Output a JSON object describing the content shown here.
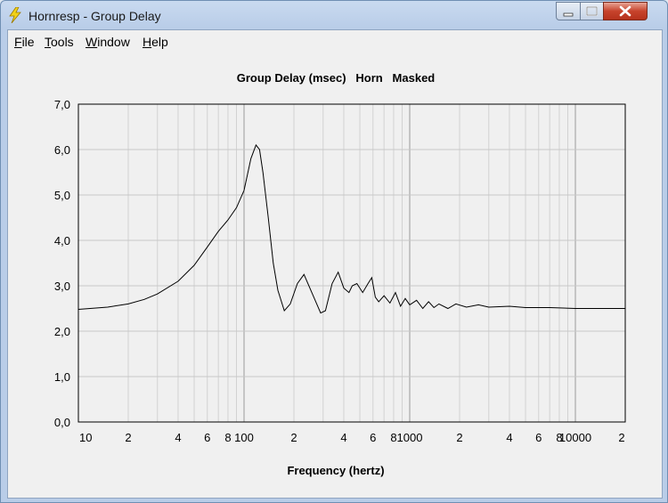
{
  "window": {
    "title": "Hornresp - Group Delay",
    "icon": "lightning-bolt-icon",
    "controls": [
      "minimize-icon",
      "maximize-icon",
      "close-icon"
    ]
  },
  "menu": {
    "items": [
      {
        "label": "File",
        "accel": "F"
      },
      {
        "label": "Tools",
        "accel": "T"
      },
      {
        "label": "Window",
        "accel": "W"
      },
      {
        "label": "Help",
        "accel": "H"
      }
    ]
  },
  "chart_data": {
    "type": "line",
    "title": "Group Delay (msec)   Horn   Masked",
    "xlabel": "Frequency (hertz)",
    "ylabel": "",
    "x_scale": "log",
    "xlim": [
      10,
      20000
    ],
    "ylim": [
      0,
      7
    ],
    "grid": true,
    "y_ticks": [
      "0,0",
      "1,0",
      "2,0",
      "3,0",
      "4,0",
      "5,0",
      "6,0",
      "7,0"
    ],
    "x_ticks": [
      {
        "v": 10,
        "label": "10"
      },
      {
        "v": 20,
        "label": "2"
      },
      {
        "v": 40,
        "label": "4"
      },
      {
        "v": 60,
        "label": "6"
      },
      {
        "v": 80,
        "label": "8"
      },
      {
        "v": 100,
        "label": "100"
      },
      {
        "v": 200,
        "label": "2"
      },
      {
        "v": 400,
        "label": "4"
      },
      {
        "v": 600,
        "label": "6"
      },
      {
        "v": 800,
        "label": "8"
      },
      {
        "v": 1000,
        "label": "1000"
      },
      {
        "v": 2000,
        "label": "2"
      },
      {
        "v": 4000,
        "label": "4"
      },
      {
        "v": 6000,
        "label": "6"
      },
      {
        "v": 8000,
        "label": "8"
      },
      {
        "v": 10000,
        "label": "10000"
      },
      {
        "v": 20000,
        "label": "2"
      }
    ],
    "series": [
      {
        "x": [
          10,
          15,
          20,
          25,
          30,
          40,
          50,
          60,
          70,
          80,
          90,
          100,
          110,
          118,
          124,
          130,
          140,
          150,
          160,
          175,
          190,
          210,
          230,
          260,
          290,
          310,
          340,
          370,
          400,
          430,
          450,
          480,
          520,
          560,
          590,
          620,
          650,
          700,
          760,
          820,
          880,
          940,
          1000,
          1100,
          1200,
          1300,
          1400,
          1500,
          1700,
          1900,
          2200,
          2600,
          3000,
          4000,
          5000,
          7000,
          10000,
          14000,
          20000
        ],
        "y": [
          2.48,
          2.53,
          2.6,
          2.7,
          2.82,
          3.1,
          3.45,
          3.85,
          4.2,
          4.45,
          4.72,
          5.1,
          5.8,
          6.1,
          6.0,
          5.5,
          4.5,
          3.5,
          2.9,
          2.45,
          2.6,
          3.05,
          3.25,
          2.8,
          2.4,
          2.45,
          3.05,
          3.3,
          2.95,
          2.85,
          3.0,
          3.05,
          2.85,
          3.05,
          3.18,
          2.75,
          2.65,
          2.78,
          2.62,
          2.85,
          2.55,
          2.72,
          2.58,
          2.68,
          2.5,
          2.65,
          2.52,
          2.6,
          2.5,
          2.6,
          2.53,
          2.58,
          2.53,
          2.55,
          2.52,
          2.52,
          2.5,
          2.5,
          2.5
        ]
      }
    ]
  }
}
